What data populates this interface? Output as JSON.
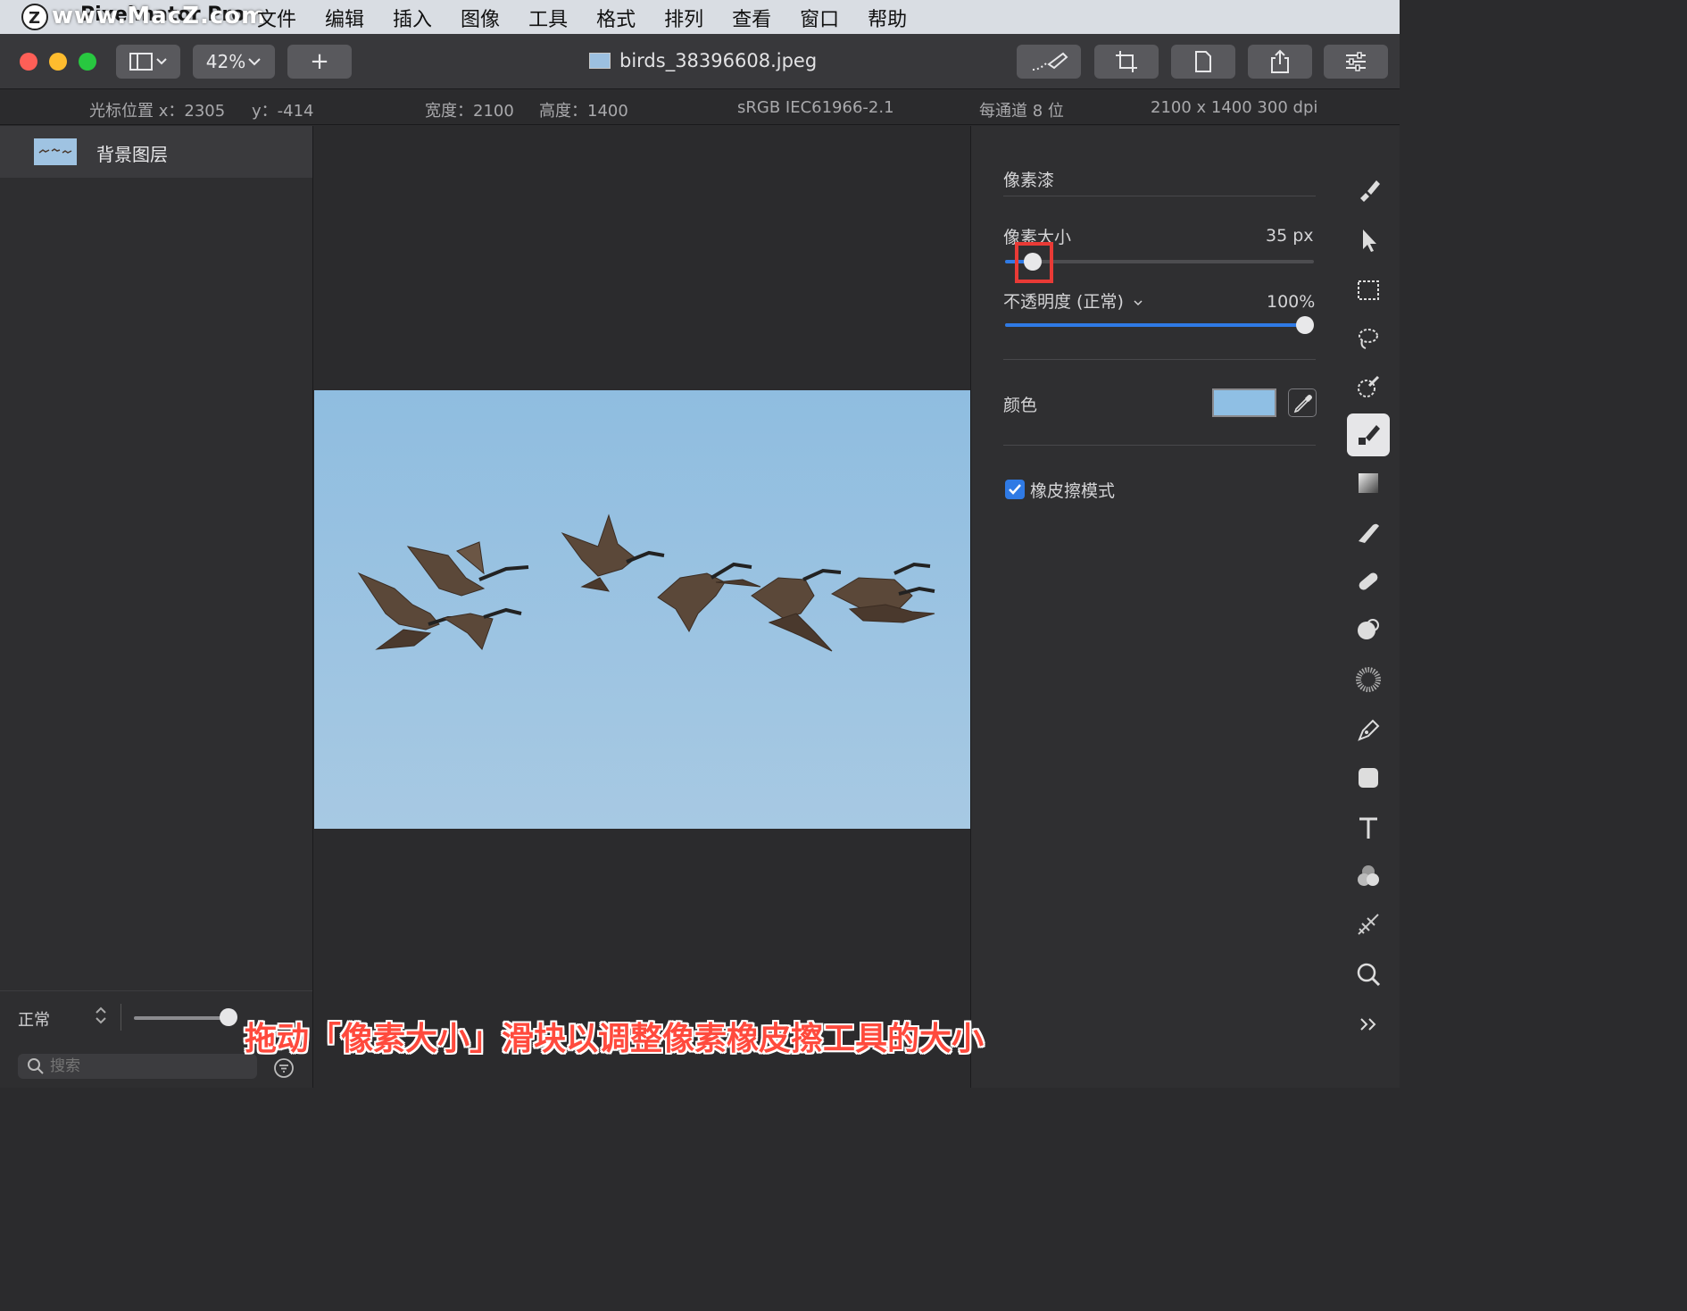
{
  "menubar": {
    "app_name": "Pixelmator Pro",
    "watermark": "www.MacZ.com",
    "menus": [
      "文件",
      "编辑",
      "插入",
      "图像",
      "工具",
      "格式",
      "排列",
      "查看",
      "窗口",
      "帮助"
    ]
  },
  "toolbar": {
    "zoom": "42%",
    "add_label": "+",
    "document_title": "birds_38396608.jpeg"
  },
  "infobar": {
    "cursor_x": "光标位置 x：2305",
    "cursor_y": "y：-414",
    "width": "宽度：2100",
    "height": "高度：1400",
    "color_profile": "sRGB IEC61966-2.1",
    "bit_depth": "每通道 8 位",
    "dimensions": "2100 x 1400 300 dpi"
  },
  "layers": {
    "items": [
      {
        "name": "背景图层"
      }
    ],
    "blend_mode": "正常",
    "opacity_value": 1.0,
    "search_placeholder": "搜索"
  },
  "inspector": {
    "tool_title": "像素漆",
    "pixel_size_label": "像素大小",
    "pixel_size_value": "35 px",
    "pixel_size_fraction": 0.09,
    "opacity_label": "不透明度 (正常)",
    "opacity_value": "100%",
    "opacity_fraction": 1.0,
    "color_label": "颜色",
    "color_value": "#8fbfe4",
    "eraser_mode_label": "橡皮擦模式",
    "eraser_mode_checked": true
  },
  "tools": [
    "paint-tool",
    "arrange-tool",
    "rect-select-tool",
    "magic-select-tool",
    "color-adjust-tool",
    "pixel-paint-tool",
    "gradient-tool",
    "retouch-tool",
    "repair-tool",
    "clone-tool",
    "effects-brush-tool",
    "pen-tool",
    "shape-tool",
    "text-tool",
    "color-fill-tool",
    "style-tool",
    "zoom-tool",
    "more-tools"
  ],
  "caption": "拖动「像素大小」滑块以调整像素橡皮擦工具的大小"
}
